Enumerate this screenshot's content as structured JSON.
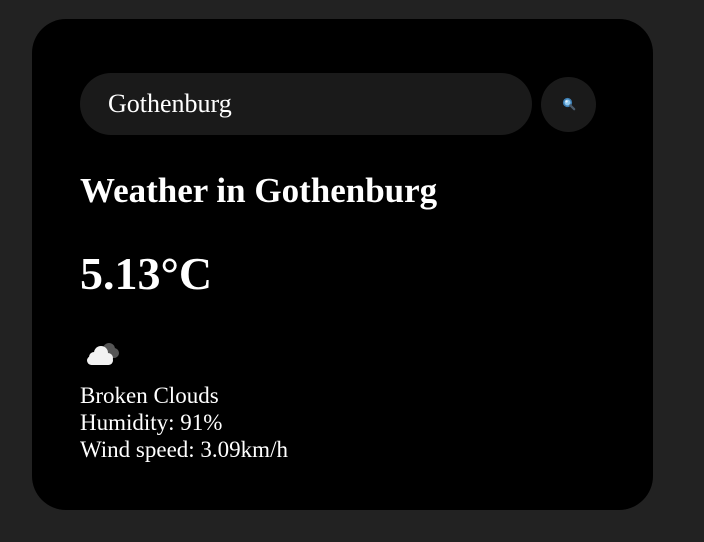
{
  "search": {
    "value": "Gothenburg",
    "icon": "search-icon"
  },
  "weather": {
    "title": "Weather in Gothenburg",
    "temperature": "5.13°C",
    "icon": "broken-clouds-icon",
    "description": "Broken Clouds",
    "humidity": "Humidity: 91%",
    "wind": "Wind speed: 3.09km/h"
  },
  "colors": {
    "page_background": "#222222",
    "card_background": "#000000",
    "input_background": "#1a1a1a",
    "text": "#ffffff"
  }
}
